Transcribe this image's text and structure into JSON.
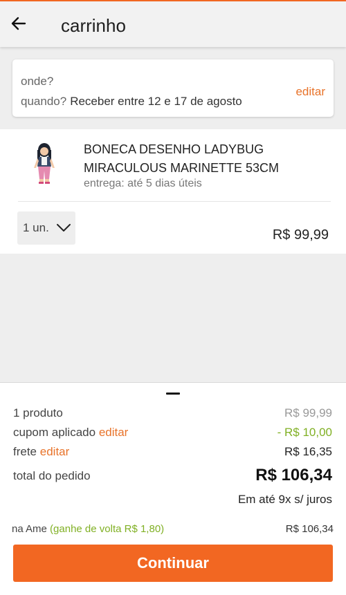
{
  "colors": {
    "accent": "#f26722",
    "edit_link": "#e8732a",
    "discount": "#80b024"
  },
  "header": {
    "title": "carrinho",
    "back_icon": "arrow-left-icon"
  },
  "delivery": {
    "where_label": "onde?",
    "when_label": "quando?",
    "when_value": "Receber entre 12 e 17 de agosto",
    "edit_label": "editar"
  },
  "cart": {
    "items": [
      {
        "name": "BONECA DESENHO LADYBUG MIRACULOUS MARINETTE 53CM",
        "delivery": "entrega: até 5 dias úteis",
        "quantity": "1 un.",
        "price": "R$ 99,99",
        "image_icon": "doll-image"
      }
    ]
  },
  "summary": {
    "products_label": "1 produto",
    "products_value": "R$ 99,99",
    "coupon_label": "cupom aplicado",
    "coupon_edit": "editar",
    "coupon_value": "- R$ 10,00",
    "shipping_label": "frete",
    "shipping_edit": "editar",
    "shipping_value": "R$ 16,35",
    "total_label": "total do pedido",
    "total_value": "R$ 106,34",
    "installments": "Em até 9x s/ juros",
    "ame_label": "na Ame",
    "ame_cashback": "(ganhe de volta R$ 1,80)",
    "ame_value": "R$ 106,34",
    "continue_label": "Continuar"
  }
}
